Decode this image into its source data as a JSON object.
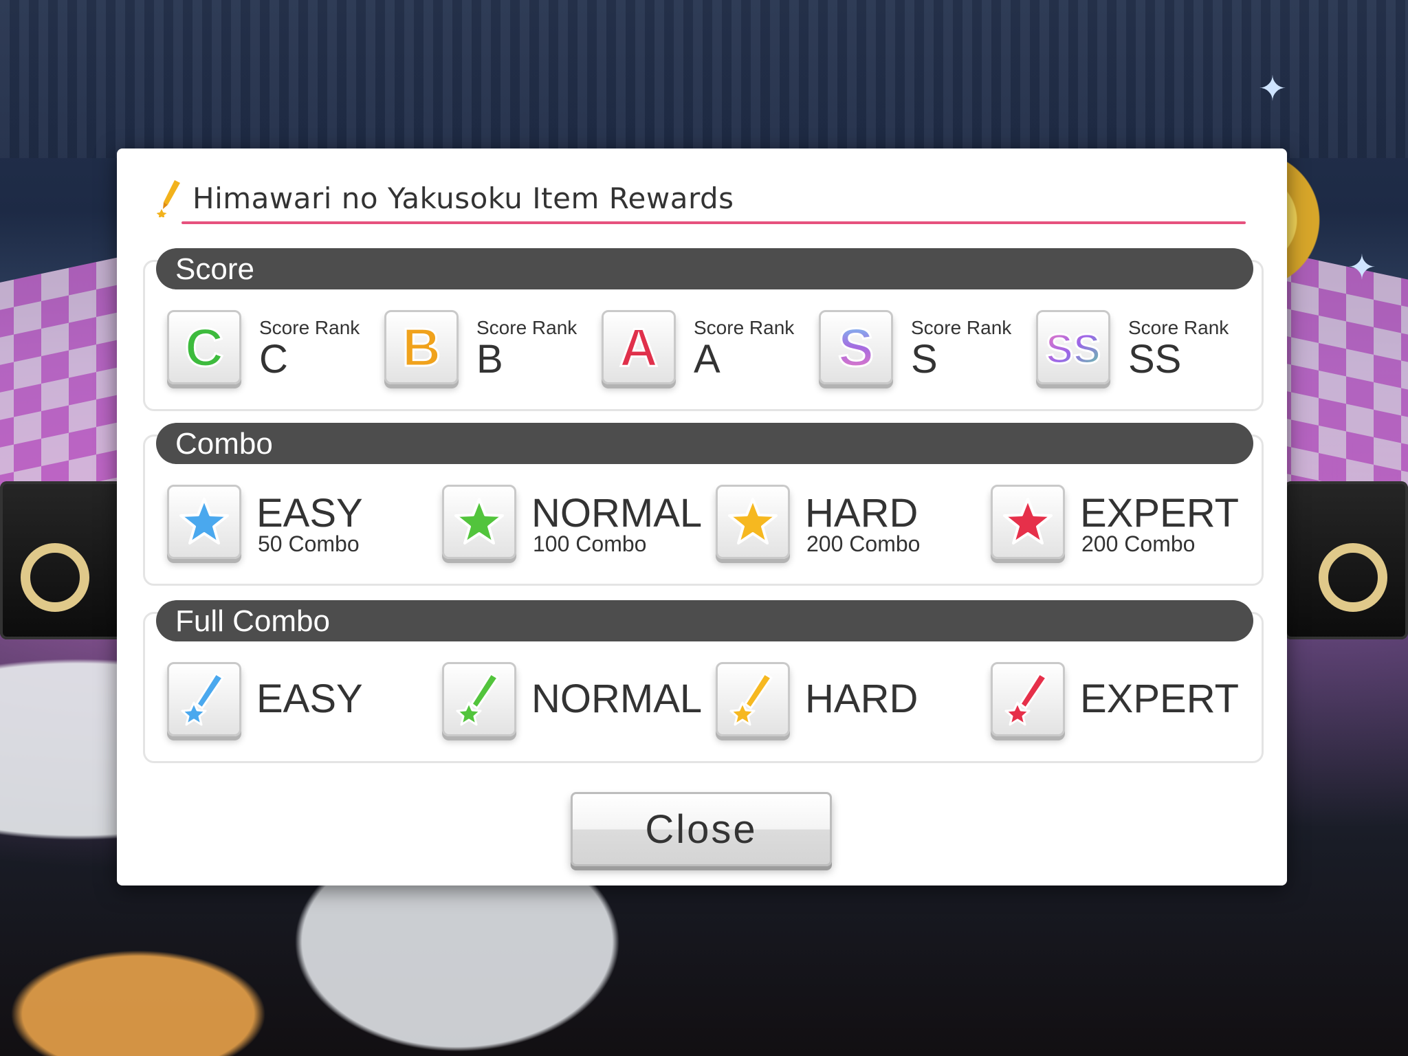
{
  "dialog": {
    "title": "Himawari no Yakusoku Item Rewards",
    "accent_color": "#e6527e"
  },
  "score": {
    "header": "Score",
    "items": [
      {
        "label": "Score Rank",
        "rank": "C",
        "icon": "rank-c-icon",
        "color": "#3dbb3d"
      },
      {
        "label": "Score Rank",
        "rank": "B",
        "icon": "rank-b-icon",
        "color": "#f0a21c"
      },
      {
        "label": "Score Rank",
        "rank": "A",
        "icon": "rank-a-icon",
        "color": "#e0304b"
      },
      {
        "label": "Score Rank",
        "rank": "S",
        "icon": "rank-s-icon",
        "color": "#a56ce0"
      },
      {
        "label": "Score Rank",
        "rank": "SS",
        "icon": "rank-ss-icon",
        "color": "#9a66e8"
      }
    ]
  },
  "combo": {
    "header": "Combo",
    "items": [
      {
        "difficulty": "EASY",
        "requirement": "50 Combo",
        "icon": "blue-star-icon",
        "color": "#4aa8ee"
      },
      {
        "difficulty": "NORMAL",
        "requirement": "100 Combo",
        "icon": "green-star-icon",
        "color": "#52c43c"
      },
      {
        "difficulty": "HARD",
        "requirement": "200 Combo",
        "icon": "yellow-star-icon",
        "color": "#f6b820"
      },
      {
        "difficulty": "EXPERT",
        "requirement": "200 Combo",
        "icon": "red-star-icon",
        "color": "#e6304a"
      }
    ]
  },
  "full_combo": {
    "header": "Full Combo",
    "items": [
      {
        "difficulty": "EASY",
        "icon": "blue-shooting-star-icon",
        "color": "#4aa8ee"
      },
      {
        "difficulty": "NORMAL",
        "icon": "green-shooting-star-icon",
        "color": "#52c43c"
      },
      {
        "difficulty": "HARD",
        "icon": "yellow-shooting-star-icon",
        "color": "#f6b820"
      },
      {
        "difficulty": "EXPERT",
        "icon": "red-shooting-star-icon",
        "color": "#e6304a"
      }
    ]
  },
  "close_button": {
    "label": "Close"
  }
}
